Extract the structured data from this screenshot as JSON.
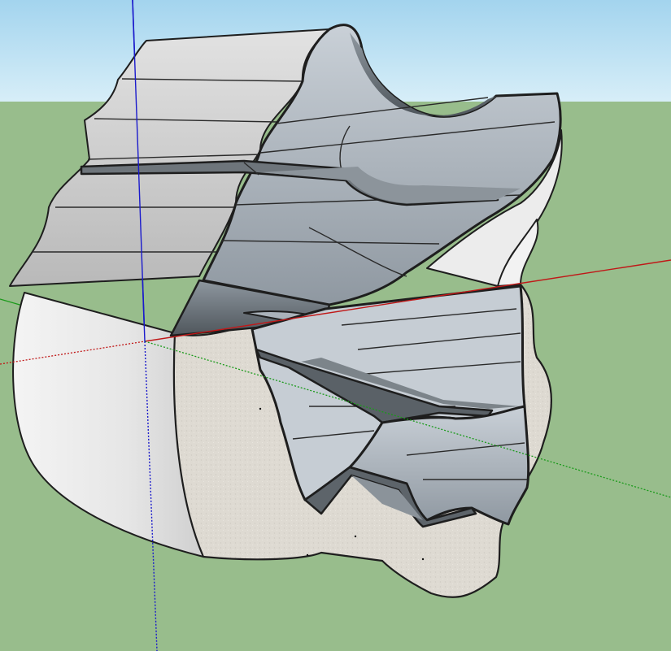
{
  "scene": {
    "sky_color": "#a8d8f0",
    "ground_color": "#98bd8c",
    "axis_colors": {
      "red": "#c01818",
      "green": "#1a9a1a",
      "blue": "#1a1acc"
    },
    "face_colors": {
      "light_surface": "#e8e8e8",
      "cut_face": "#dcdcd8",
      "steel_light": "#c3cbd3",
      "steel_mid": "#9aa4ad",
      "steel_dark": "#5b6268",
      "outline": "#1e1e1e"
    }
  }
}
